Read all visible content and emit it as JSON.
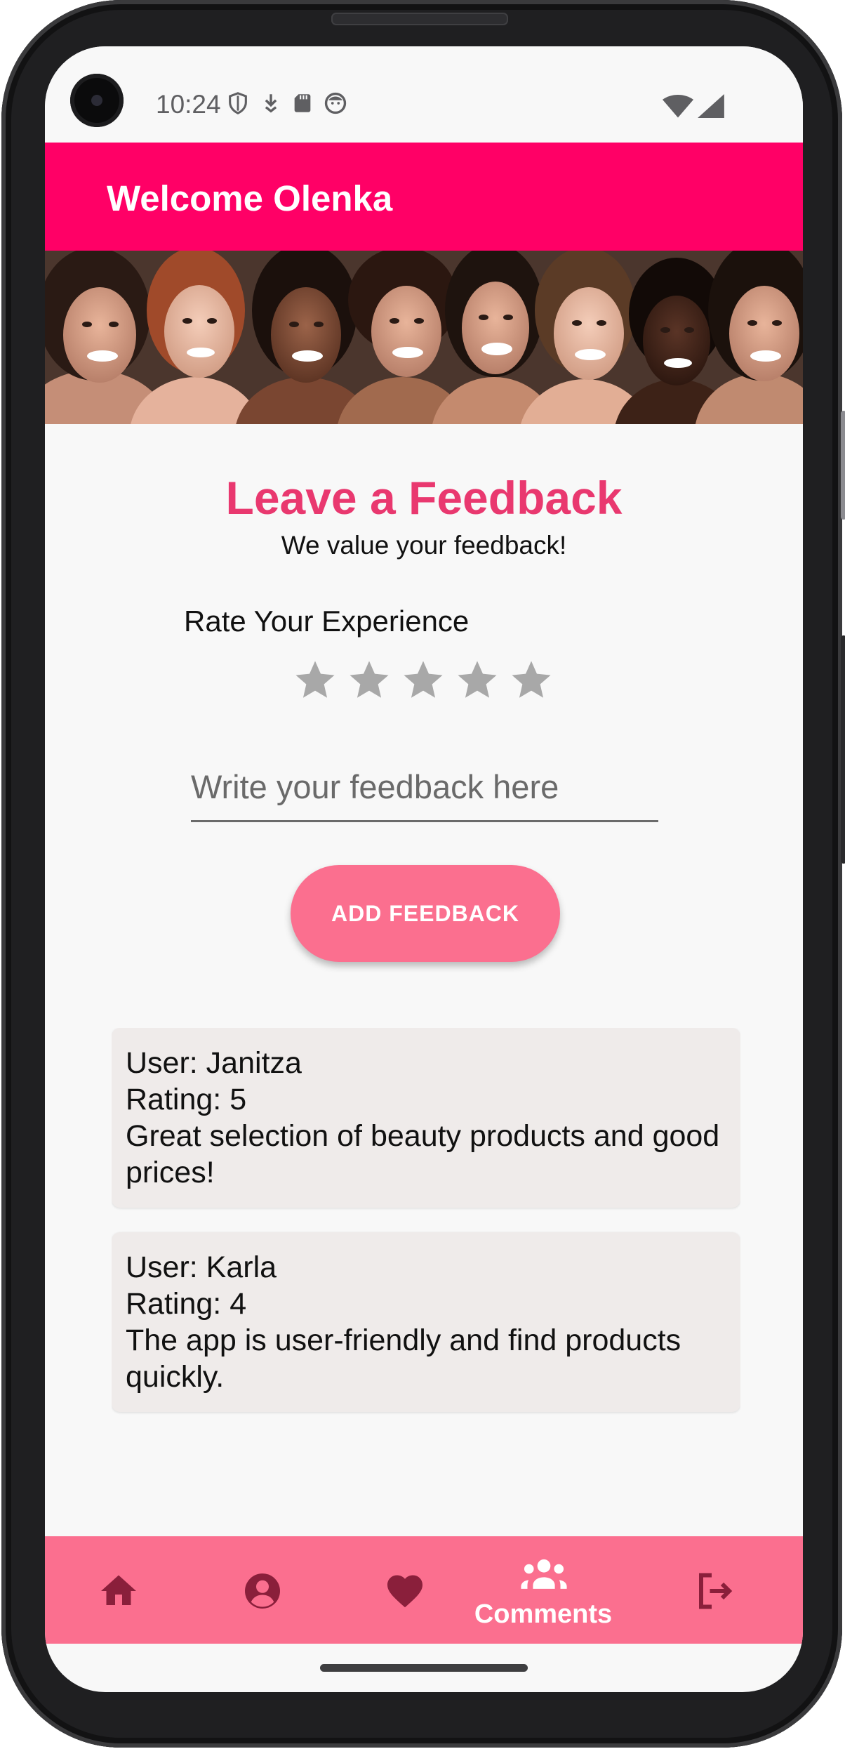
{
  "status_bar": {
    "time": "10:24"
  },
  "app_bar": {
    "title": "Welcome Olenka"
  },
  "feedback_form": {
    "title": "Leave a Feedback",
    "subtitle": "We value your feedback!",
    "rating_label": "Rate Your Experience",
    "rating_value": 0,
    "rating_max": 5,
    "input_value": "",
    "input_placeholder": "Write your feedback here",
    "submit_label": "ADD FEEDBACK"
  },
  "feedback_list": [
    {
      "user_line": "User: Janitza",
      "rating_line": "Rating: 5",
      "comment": "Great selection of beauty products and good prices!"
    },
    {
      "user_line": "User: Karla",
      "rating_line": "Rating: 4",
      "comment": "The app is user-friendly and find products quickly."
    }
  ],
  "bottom_nav": {
    "items": [
      {
        "icon": "home-icon",
        "label": ""
      },
      {
        "icon": "account-icon",
        "label": ""
      },
      {
        "icon": "heart-icon",
        "label": ""
      },
      {
        "icon": "group-icon",
        "label": "Comments",
        "selected": true
      },
      {
        "icon": "logout-icon",
        "label": ""
      }
    ]
  },
  "colors": {
    "app_bar": "#ff0066",
    "accent_title": "#e9386f",
    "button": "#fb6f8f",
    "bottom_nav": "#fb6f8f",
    "nav_icon_inactive": "#8a1f3b",
    "star_inactive": "#a8a8a8",
    "card_bg": "#efebea"
  }
}
